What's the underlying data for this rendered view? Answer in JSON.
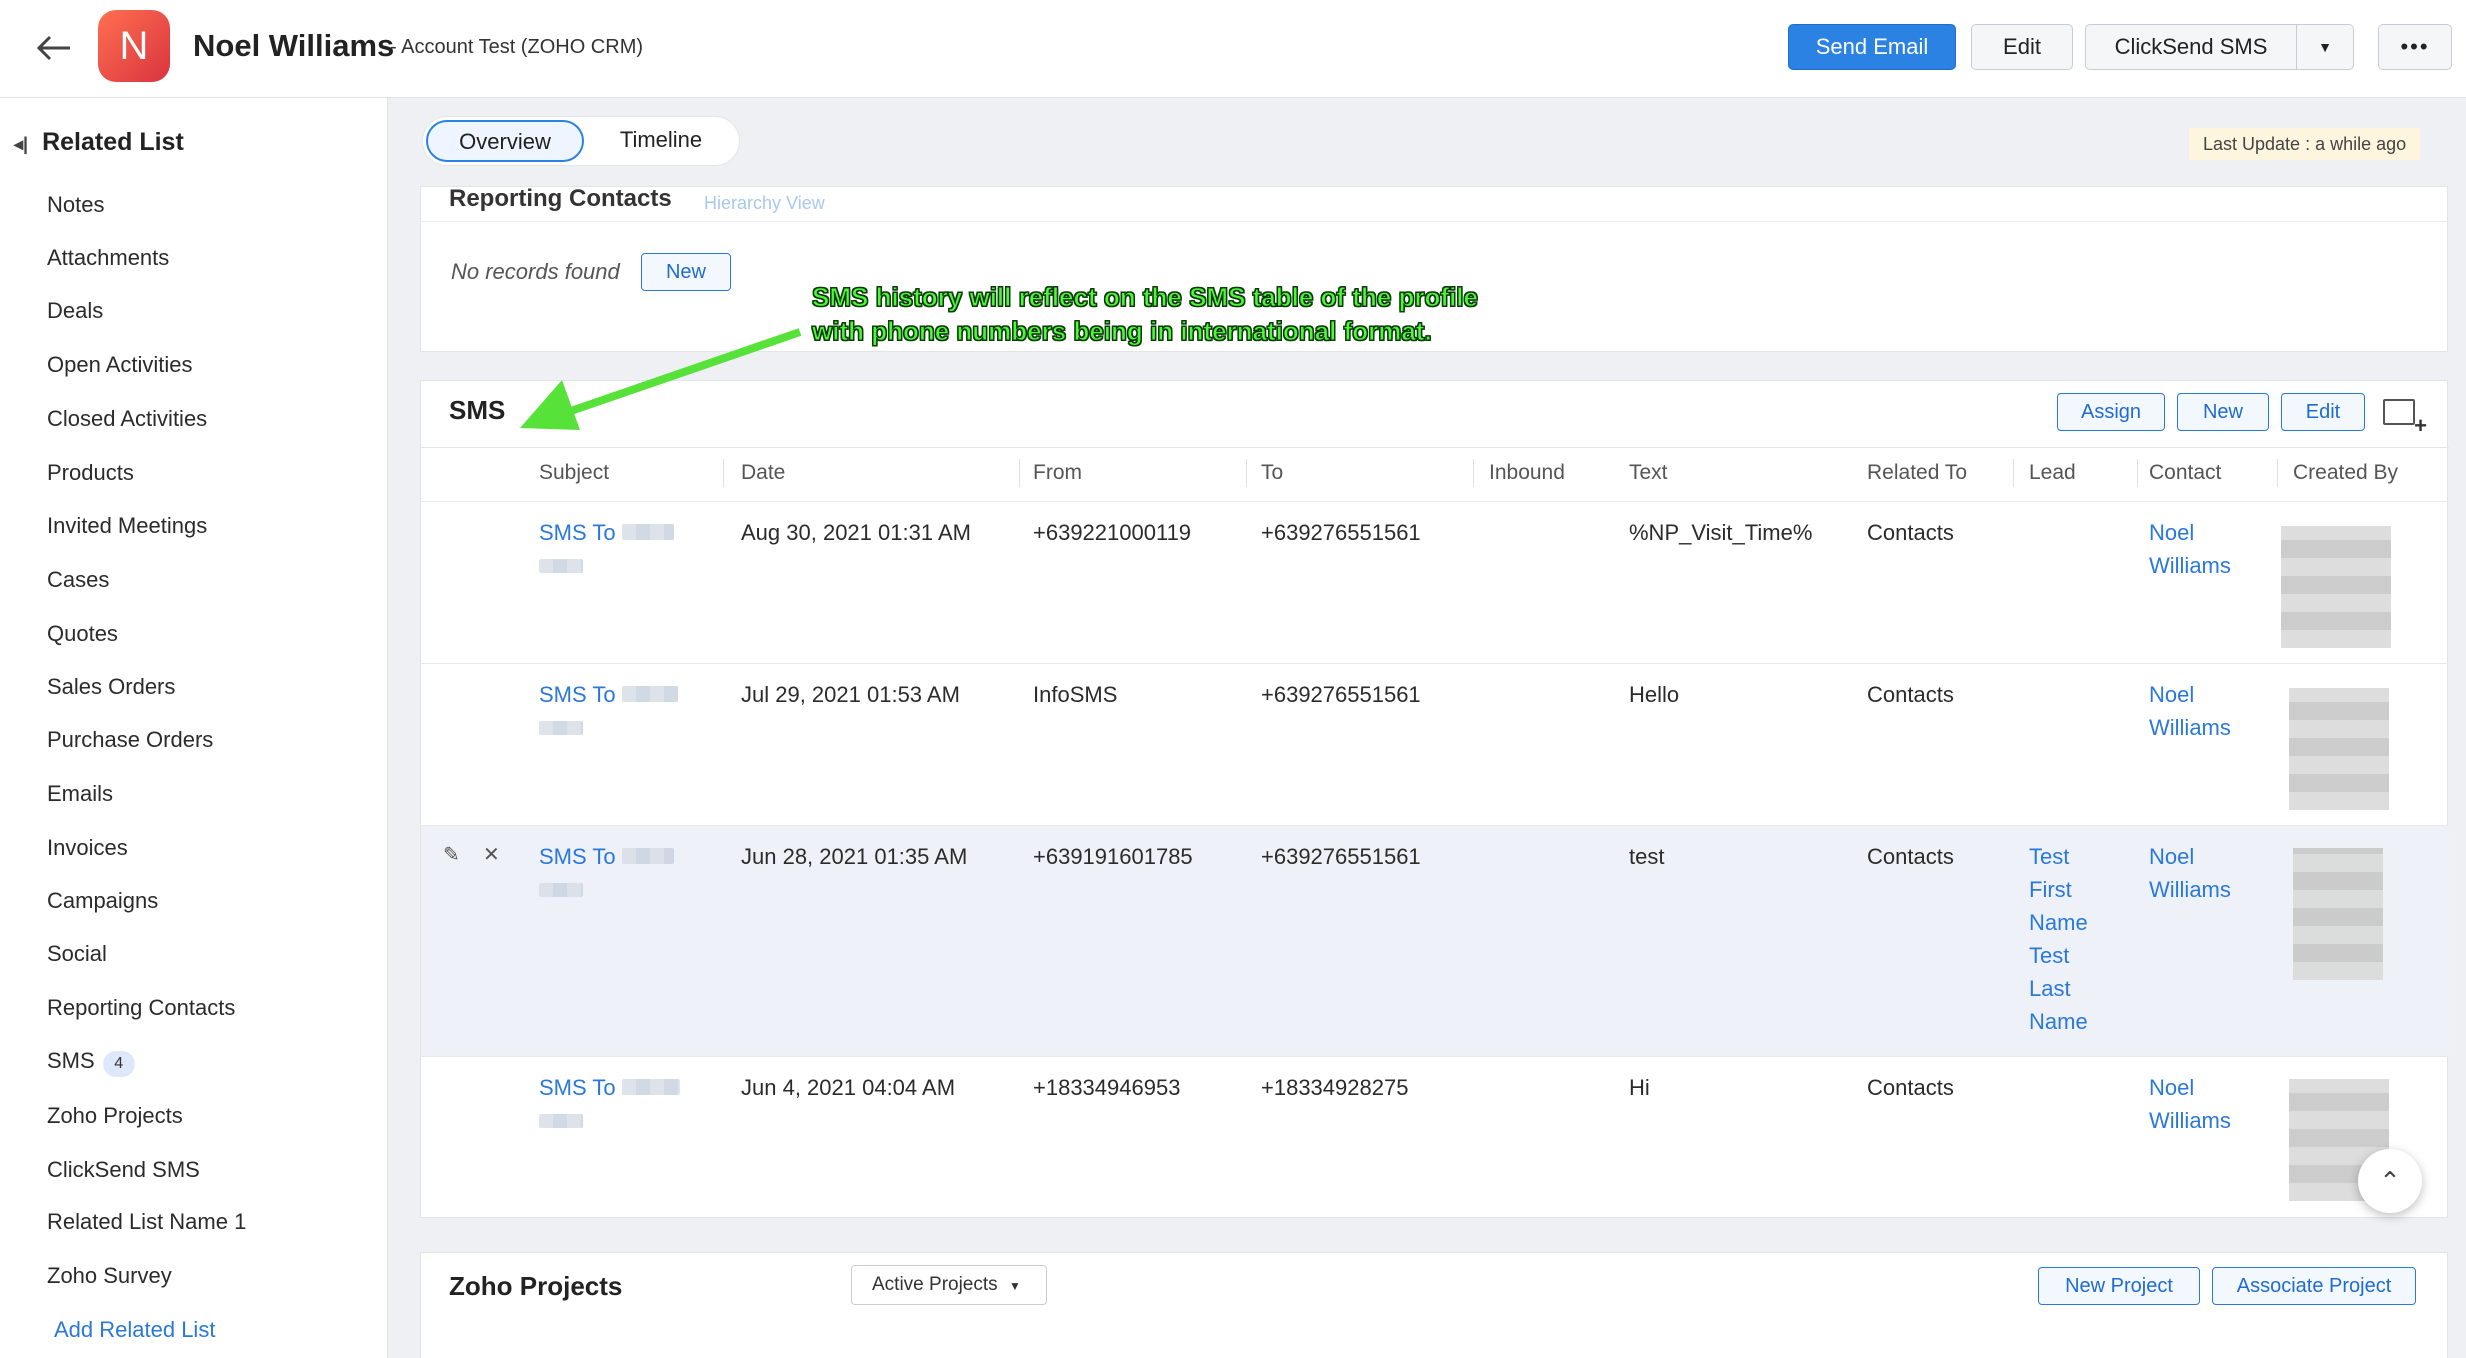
{
  "header": {
    "avatar_letter": "N",
    "record_name": "Noel Williams",
    "record_sub": "- Account Test (ZOHO CRM)",
    "buttons": {
      "send_email": "Send Email",
      "edit": "Edit",
      "clicksend": "ClickSend SMS",
      "more": "•••"
    }
  },
  "sidebar": {
    "title": "Related List",
    "items": [
      "Notes",
      "Attachments",
      "Deals",
      "Open Activities",
      "Closed Activities",
      "Products",
      "Invited Meetings",
      "Cases",
      "Quotes",
      "Sales Orders",
      "Purchase Orders",
      "Emails",
      "Invoices",
      "Campaigns",
      "Social",
      "Reporting Contacts",
      "SMS",
      "Zoho Projects",
      "ClickSend SMS",
      "Related List Name 1",
      "Zoho Survey"
    ],
    "sms_count": "4",
    "add_related": "Add Related List"
  },
  "tabs": {
    "overview": "Overview",
    "timeline": "Timeline"
  },
  "last_update": "Last Update : a while ago",
  "reporting_contacts": {
    "title": "Reporting Contacts",
    "hierarchy": "Hierarchy View",
    "empty": "No records found",
    "new_label": "New"
  },
  "annotation": {
    "line1": "SMS history will reflect on the SMS table of the profile",
    "line2": "with phone numbers being in international format."
  },
  "sms": {
    "title": "SMS",
    "actions": {
      "assign": "Assign",
      "new": "New",
      "edit": "Edit"
    },
    "columns": [
      "Subject",
      "Date",
      "From",
      "To",
      "Inbound",
      "Text",
      "Related To",
      "Lead",
      "Contact",
      "Created By"
    ],
    "rows": [
      {
        "subject": "SMS To",
        "date": "Aug 30, 2021 01:31 AM",
        "from": "+639221000119",
        "to": "+639276551561",
        "text": "%NP_Visit_Time%",
        "related": "Contacts",
        "lead": "",
        "contact1": "Noel",
        "contact2": "Williams"
      },
      {
        "subject": "SMS To",
        "date": "Jul 29, 2021 01:53 AM",
        "from": "InfoSMS",
        "to": "+639276551561",
        "text": "Hello",
        "related": "Contacts",
        "lead": "",
        "contact1": "Noel",
        "contact2": "Williams"
      },
      {
        "subject": "SMS To",
        "date": "Jun 28, 2021 01:35 AM",
        "from": "+639191601785",
        "to": "+639276551561",
        "text": "test",
        "related": "Contacts",
        "lead1": "Test",
        "lead2": "First",
        "lead3": "Name",
        "lead4": "Test",
        "lead5": "Last",
        "lead6": "Name",
        "contact1": "Noel",
        "contact2": "Williams"
      },
      {
        "subject": "SMS To",
        "date": "Jun 4, 2021 04:04 AM",
        "from": "+18334946953",
        "to": "+18334928275",
        "text": "Hi",
        "related": "Contacts",
        "lead": "",
        "contact1": "Noel",
        "contact2": "Williams"
      }
    ]
  },
  "zoho_projects": {
    "title": "Zoho Projects",
    "filter": "Active Projects",
    "new_project": "New Project",
    "associate": "Associate Project"
  }
}
